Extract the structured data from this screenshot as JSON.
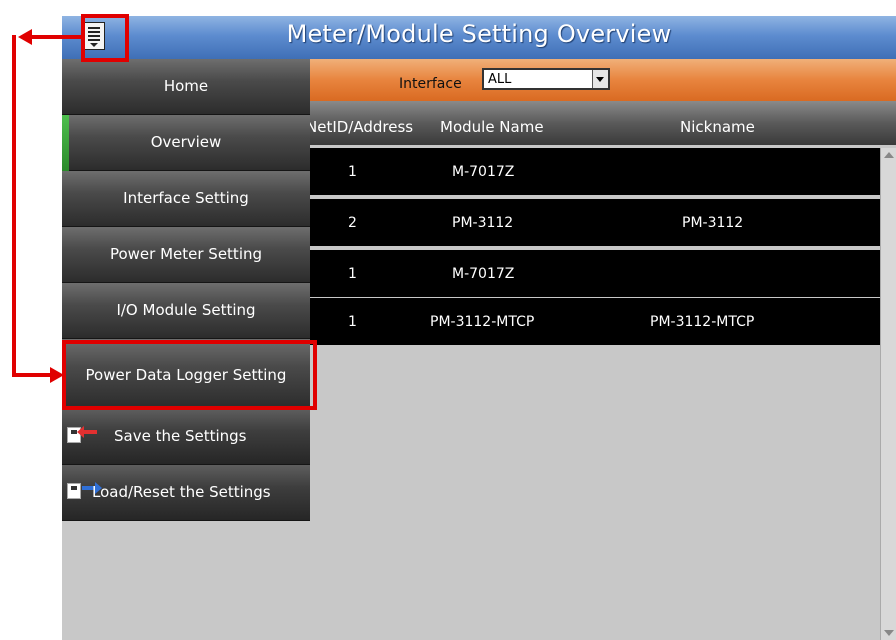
{
  "window": {
    "title": "Meter/Module Setting Overview"
  },
  "filter": {
    "label": "Interface",
    "selected": "ALL"
  },
  "table": {
    "headers": [
      "NetID/Address",
      "Module Name",
      "Nickname"
    ],
    "rows": [
      {
        "address": "1",
        "module": "M-7017Z",
        "nickname": ""
      },
      {
        "address": "2",
        "module": "PM-3112",
        "nickname": "PM-3112"
      },
      {
        "address": "1",
        "module": "M-7017Z",
        "nickname": ""
      },
      {
        "address": "1",
        "module": "PM-3112-MTCP",
        "nickname": "PM-3112-MTCP"
      }
    ]
  },
  "sidebar": {
    "items": [
      {
        "label": "Home"
      },
      {
        "label": "Overview"
      },
      {
        "label": "Interface Setting"
      },
      {
        "label": "Power Meter Setting"
      },
      {
        "label": "I/O Module Setting"
      },
      {
        "label": "Power Data Logger Setting"
      },
      {
        "label": "Save the Settings",
        "icon": "save-disk-icon"
      },
      {
        "label": "Load/Reset the Settings",
        "icon": "load-disk-icon"
      }
    ]
  },
  "colors": {
    "titlebar": "#5d8ccf",
    "filterbar": "#e8843e",
    "annotation": "#e00000",
    "active_indicator": "#3aa53a"
  }
}
